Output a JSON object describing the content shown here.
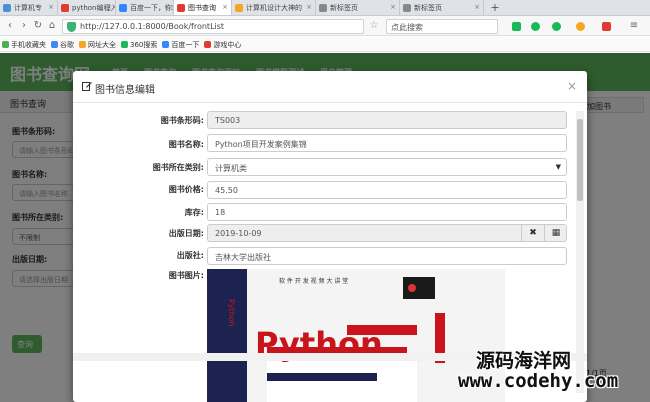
{
  "browser": {
    "tabs": [
      {
        "label": "计算机专",
        "color": "#4a90d9"
      },
      {
        "label": "python编程入门",
        "color": "#e03b2e"
      },
      {
        "label": "百度一下，你就",
        "color": "#3385ff"
      },
      {
        "label": "图书查询",
        "color": "#e03b2e",
        "active": true
      },
      {
        "label": "计算机设计大神的",
        "color": "#f5a623",
        "wide": true
      },
      {
        "label": "新标签页",
        "color": "#888888",
        "wide": true
      },
      {
        "label": "新标签页",
        "color": "#888888",
        "wide": true
      }
    ],
    "new_tab": "+",
    "url": "http://127.0.0.1:8000/Book/frontList",
    "search_placeholder": "点此搜索",
    "bookmarks": [
      {
        "label": "手机收藏夹",
        "color": "#4caf50"
      },
      {
        "label": "谷歌",
        "color": "#4285f4"
      },
      {
        "label": "网址大全",
        "color": "#f5a623"
      },
      {
        "label": "360搜索",
        "color": "#19b955"
      },
      {
        "label": "百度一下",
        "color": "#3385ff"
      },
      {
        "label": "游戏中心",
        "color": "#e03b2e"
      }
    ]
  },
  "page": {
    "brand": "图书查询网",
    "nav": [
      "首页",
      "图书查询",
      "图书查询添加",
      "图书模型测试",
      "用户管理"
    ],
    "panel_title": "图书查询",
    "filters": {
      "barcode_label": "图书条形码:",
      "barcode_placeholder": "请输入图书条形码",
      "name_label": "图书名称:",
      "name_placeholder": "请输入图书名称",
      "type_label": "图书所在类别:",
      "type_value": "不限制",
      "date_label": "出版日期:",
      "date_placeholder": "请选择出版日期",
      "query_button": "查询"
    },
    "add_button": "添加图书",
    "pager": "当前第1/1页"
  },
  "modal": {
    "title": "图书信息编辑",
    "fields": {
      "barcode": {
        "label": "图书条形码:",
        "value": "TS003"
      },
      "name": {
        "label": "图书名称:",
        "value": "Python项目开发案例集锦"
      },
      "type": {
        "label": "图书所在类别:",
        "value": "计算机类"
      },
      "price": {
        "label": "图书价格:",
        "value": "45.50"
      },
      "count": {
        "label": "库存:",
        "value": "18"
      },
      "publish_date": {
        "label": "出版日期:",
        "value": "2019-10-09"
      },
      "publisher": {
        "label": "出版社:",
        "value": "吉林大学出版社"
      },
      "photo": {
        "label": "图书图片:"
      }
    },
    "cover": {
      "top_text": "软 件 开 发 视 频 大 讲 堂",
      "title": "Python",
      "spine_text": "Python"
    }
  },
  "watermark": {
    "line1": "源码海洋网",
    "line2": "www.codehy.com"
  },
  "colors": {
    "navbar": "#5cb85c",
    "backdrop": "rgba(0,0,0,0.5)"
  }
}
